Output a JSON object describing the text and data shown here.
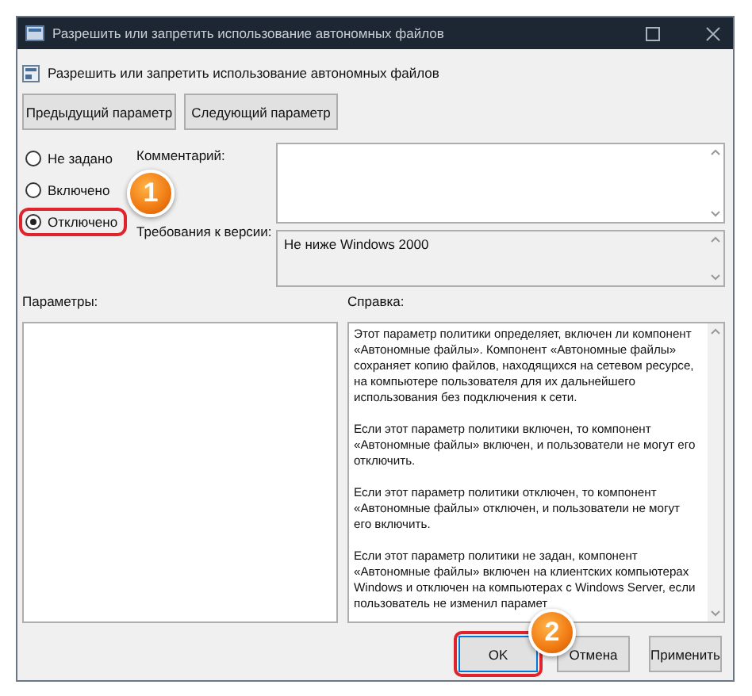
{
  "window": {
    "title": "Разрешить или запретить использование автономных файлов"
  },
  "policy": {
    "name": "Разрешить или запретить использование автономных файлов"
  },
  "nav_buttons": [
    "Предыдущий параметр",
    "Следующий параметр"
  ],
  "states": [
    {
      "label": "Не задано",
      "selected": false,
      "highlighted": false
    },
    {
      "label": "Включено",
      "selected": false,
      "highlighted": false,
      "badge": "1"
    },
    {
      "label": "Отключено",
      "selected": true,
      "highlighted": true
    }
  ],
  "comment": {
    "label": "Комментарий:"
  },
  "requirements": {
    "label": "Требования к версии:",
    "value": "Не ниже Windows 2000"
  },
  "options": {
    "label": "Параметры:"
  },
  "help": {
    "label": "Справка:",
    "paragraphs": [
      [
        "Этот параметр политики определяет, включен ли компонент",
        "«Автономные файлы». Компонент «Автономные файлы»",
        "сохраняет копию файлов, находящихся на сетевом ресурсе,",
        "на компьютере пользователя для их дальнейшего",
        "использования без подключения к сети."
      ],
      [
        "Если этот параметр политики включен, то компонент",
        "«Автономные файлы» включен, и пользователи не могут его",
        "отключить."
      ],
      [
        "Если этот параметр политики отключен, то компонент",
        "«Автономные файлы» отключен, и пользователи не могут",
        "его включить."
      ],
      [
        "Если этот параметр политики не задан, компонент",
        "«Автономные файлы» включен на клиентских компьютерах",
        "Windows и отключен на компьютерах с Windows Server, если",
        "пользователь не изменил парамет"
      ]
    ]
  },
  "dialog_buttons": [
    {
      "label": "OK",
      "highlighted": true,
      "badge": "2"
    },
    {
      "label": "Отмена",
      "highlighted": false
    },
    {
      "label": "Применить",
      "highlighted": false
    }
  ]
}
